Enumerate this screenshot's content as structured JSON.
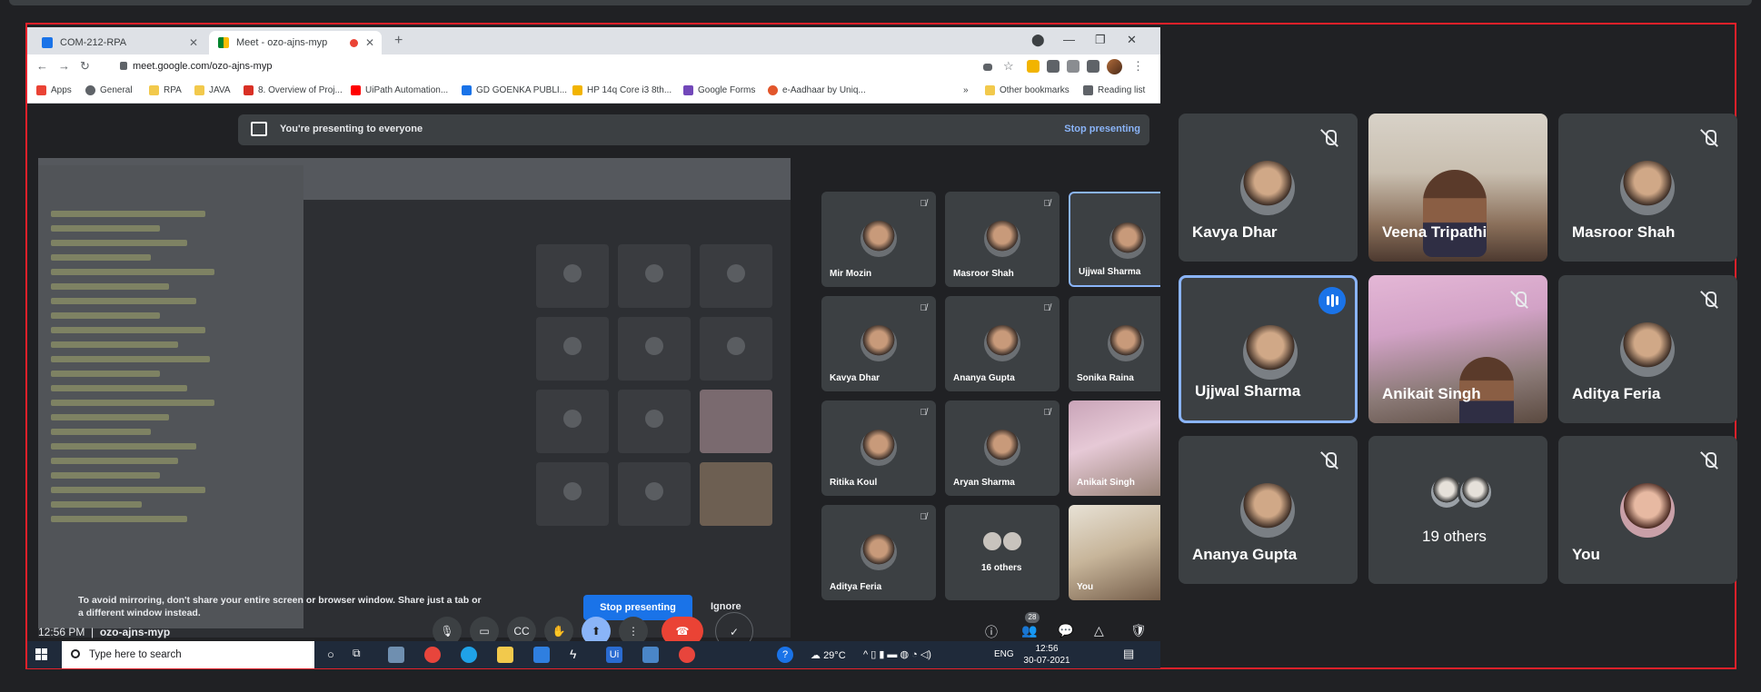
{
  "browser": {
    "tabs": [
      {
        "label": "COM-212-RPA"
      },
      {
        "label": "Meet - ozo-ajns-myp"
      }
    ],
    "url": "meet.google.com/ozo-ajns-myp",
    "bookmarks": [
      "Apps",
      "General",
      "RPA",
      "JAVA",
      "8. Overview of Proj...",
      "UiPath Automation...",
      "GD GOENKA PUBLI...",
      "HP 14q Core i3 8th...",
      "Google Forms",
      "e-Aadhaar by Uniq..."
    ],
    "bookmarks_right": [
      "»",
      "Other bookmarks",
      "Reading list"
    ]
  },
  "presenting": {
    "banner": "You're presenting to everyone",
    "stop_link": "Stop presenting",
    "warning": "To avoid mirroring, don't share your entire screen or browser window. Share just a tab or a different window instead.",
    "stop_button": "Stop presenting",
    "ignore_button": "Ignore"
  },
  "shared_tiles": [
    {
      "name": "Mir Mozin"
    },
    {
      "name": "Masroor Shah"
    },
    {
      "name": "Ujjwal Sharma"
    },
    {
      "name": "Kavya Dhar"
    },
    {
      "name": "Ananya Gupta"
    },
    {
      "name": "Sonika Raina"
    },
    {
      "name": "Ritika Koul"
    },
    {
      "name": "Aryan Sharma"
    },
    {
      "name": "Anikait Singh"
    },
    {
      "name": "Aditya Feria"
    },
    {
      "name": "16 others"
    },
    {
      "name": "You"
    }
  ],
  "meeting": {
    "time": "12:56 PM",
    "code": "ozo-ajns-myp",
    "people_count": "28"
  },
  "taskbar": {
    "search_placeholder": "Type here to search",
    "weather": "29°C",
    "lang": "ENG",
    "clock_time": "12:56",
    "clock_date": "30-07-2021"
  },
  "tiles": [
    {
      "name": "Kavya Dhar"
    },
    {
      "name": "Veena Tripathi"
    },
    {
      "name": "Masroor Shah"
    },
    {
      "name": "Ujjwal Sharma"
    },
    {
      "name": "Anikait Singh"
    },
    {
      "name": "Aditya Feria"
    },
    {
      "name": "Ananya Gupta"
    },
    {
      "name": "19 others"
    },
    {
      "name": "You"
    }
  ],
  "colors": {
    "accent": "#8ab4f8",
    "frame_border": "#e8202a",
    "speaking_badge": "#1a73e8"
  }
}
